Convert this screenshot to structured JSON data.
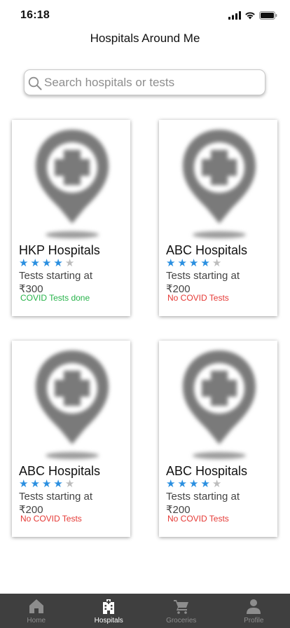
{
  "status_bar": {
    "time": "16:18"
  },
  "header": {
    "title": "Hospitals Around Me"
  },
  "search": {
    "placeholder": "Search hospitals or tests",
    "value": ""
  },
  "colors": {
    "covid_done": "#27b34a",
    "no_covid": "#e53935",
    "star_active": "#2a8fe0",
    "star_inactive": "#bdbdbd",
    "tab_bar": "#3f3f3f"
  },
  "hospitals": [
    {
      "name": "HKP Hospitals",
      "rating": 4,
      "max_rating": 5,
      "tests_line1": "Tests starting at",
      "tests_price": "₹300",
      "covid_text": "COVID Tests done",
      "covid_status": "done",
      "icon": "hospital-pin-icon"
    },
    {
      "name": "ABC Hospitals",
      "rating": 4,
      "max_rating": 5,
      "tests_line1": "Tests starting at",
      "tests_price": "₹200",
      "covid_text": "No COVID Tests",
      "covid_status": "none",
      "icon": "hospital-pin-icon"
    },
    {
      "name": "ABC Hospitals",
      "rating": 4,
      "max_rating": 5,
      "tests_line1": "Tests starting at",
      "tests_price": "₹200",
      "covid_text": "No COVID Tests",
      "covid_status": "none",
      "icon": "hospital-pin-icon"
    },
    {
      "name": "ABC Hospitals",
      "rating": 4,
      "max_rating": 5,
      "tests_line1": "Tests starting at",
      "tests_price": "₹200",
      "covid_text": "No COVID Tests",
      "covid_status": "none",
      "icon": "hospital-pin-icon"
    }
  ],
  "tab_bar": {
    "items": [
      {
        "label": "Home",
        "icon": "home-icon",
        "active": false
      },
      {
        "label": "Hospitals",
        "icon": "hospital-building-icon",
        "active": true
      },
      {
        "label": "Groceries",
        "icon": "cart-icon",
        "active": false
      },
      {
        "label": "Profile",
        "icon": "person-icon",
        "active": false
      }
    ]
  }
}
